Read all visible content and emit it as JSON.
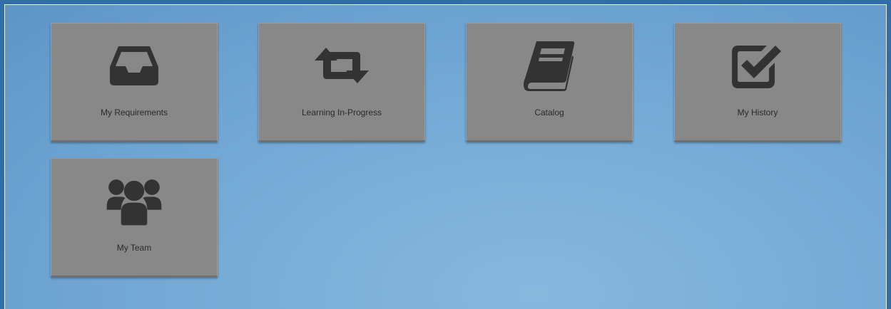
{
  "tiles": [
    {
      "label": "My Requirements",
      "icon": "inbox-icon"
    },
    {
      "label": "Learning In-Progress",
      "icon": "retweet-icon"
    },
    {
      "label": "Catalog",
      "icon": "book-icon"
    },
    {
      "label": "My History",
      "icon": "checkbox-icon"
    },
    {
      "label": "My Team",
      "icon": "group-icon"
    }
  ],
  "colors": {
    "tile_background": "#888888",
    "icon": "#333333",
    "panel_background": "#7bb0da",
    "frame": "#2f6ea8"
  }
}
